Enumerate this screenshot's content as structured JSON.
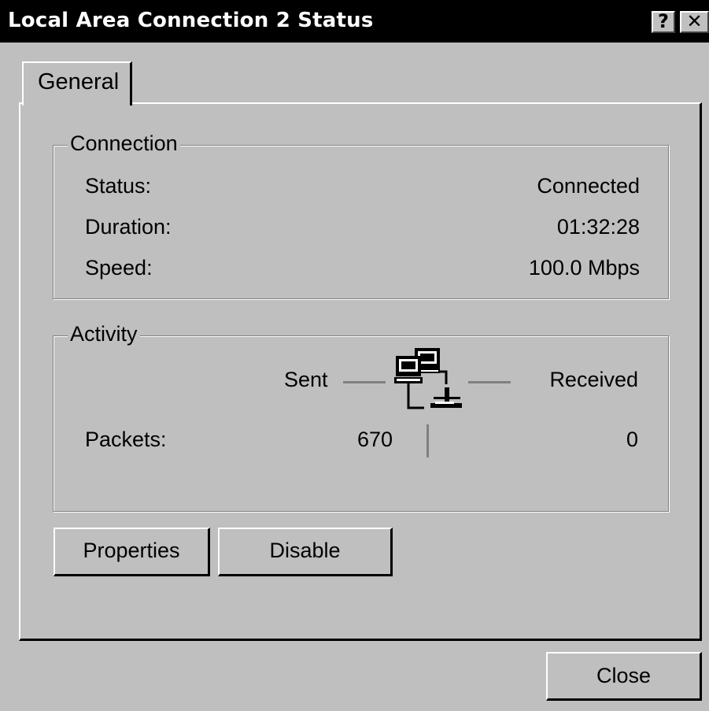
{
  "window": {
    "title": "Local Area Connection 2 Status",
    "help_button": "?",
    "close_button": "✕"
  },
  "tabs": [
    {
      "label": "General",
      "selected": true
    }
  ],
  "connection": {
    "legend": "Connection",
    "rows": [
      {
        "label": "Status:",
        "value": "Connected"
      },
      {
        "label": "Duration:",
        "value": "01:32:28"
      },
      {
        "label": "Speed:",
        "value": "100.0 Mbps"
      }
    ]
  },
  "activity": {
    "legend": "Activity",
    "sent_label": "Sent",
    "received_label": "Received",
    "packets_label": "Packets:",
    "packets_sent": "670",
    "packets_received": "0",
    "icon": "network-computers-icon"
  },
  "buttons": {
    "properties": "Properties",
    "disable": "Disable",
    "close": "Close"
  },
  "colors": {
    "background": "#bfbfbf",
    "titlebar": "#000000",
    "title_text": "#ffffff"
  }
}
